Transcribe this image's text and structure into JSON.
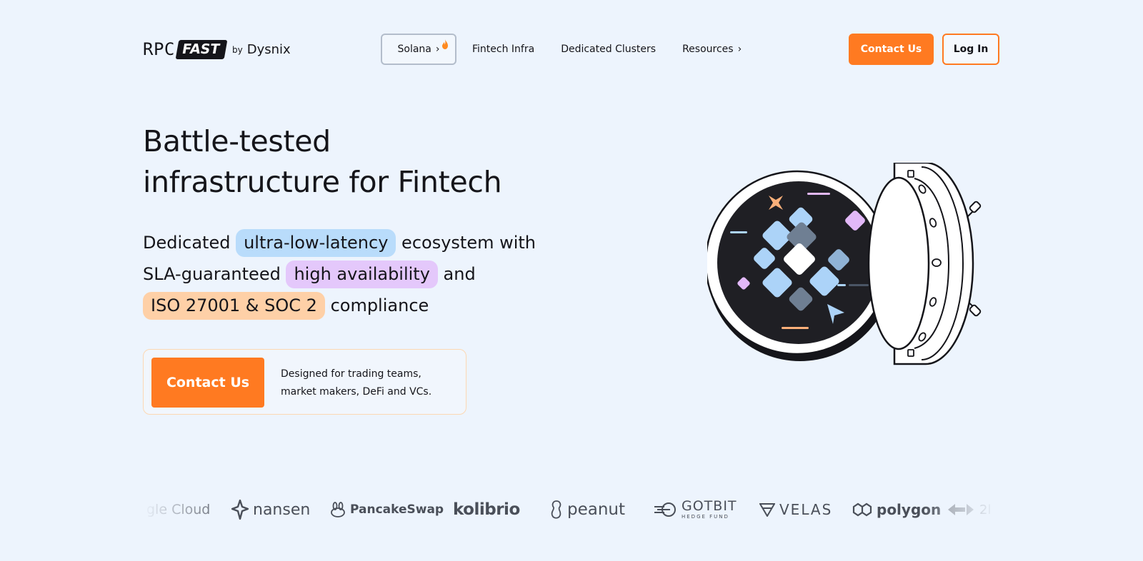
{
  "header": {
    "logo": {
      "rpc": "RPC",
      "fast": "FAST",
      "by": "by",
      "dysnix": "Dysnix"
    },
    "nav": [
      {
        "label": "Solana",
        "has_chevron": true,
        "badge_icon": "fire-icon"
      },
      {
        "label": "Fintech Infra"
      },
      {
        "label": "Dedicated Clusters"
      },
      {
        "label": "Resources",
        "has_chevron": true
      }
    ],
    "contact_label": "Contact Us",
    "login_label": "Log In"
  },
  "hero": {
    "title_line1": "Battle-tested",
    "title_line2": "infrastructure for Fintech",
    "sub": {
      "r1_pre": "Dedicated ",
      "r1_pill": "ultra-low-latency",
      "r1_post": " ecosystem with",
      "r2_pre": "SLA-guaranteed ",
      "r2_pill": "high availability",
      "r2_post": " and",
      "r3_pill": "ISO 27001 & SOC 2",
      "r3_post": " compliance"
    },
    "cta": {
      "button_label": "Contact Us",
      "text_line1": "Designed for trading teams,",
      "text_line2": "market makers, DeFi and VCs."
    }
  },
  "partners": {
    "google": "gle Cloud",
    "nansen": "nansen",
    "pancakeswap": "PancakeSwap",
    "kolibrio": "kolibrio",
    "peanut": "peanut",
    "gotbit": "GOTBIT",
    "gotbit_sub": "HEDGE FUND",
    "velas": "VELAS",
    "polygon": "polygon",
    "wormhole": "2l"
  },
  "colors": {
    "background": "#edf4fd",
    "accent": "#ff7a21",
    "text": "#15151a",
    "pill_blue": "#b9dcfb",
    "pill_purple": "#e4c8fb",
    "pill_peach": "#fed0a7"
  }
}
